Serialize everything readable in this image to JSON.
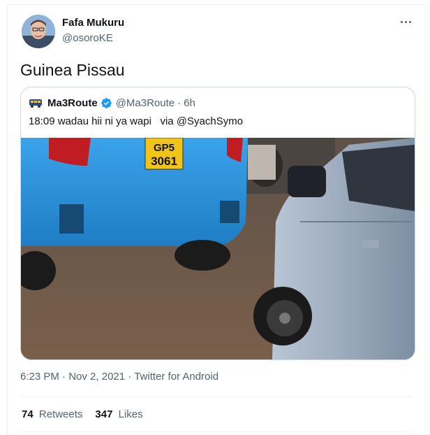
{
  "tweet": {
    "author": {
      "name": "Fafa Mukuru",
      "handle": "@osoroKE"
    },
    "text": "Guinea Pissau",
    "quoted": {
      "name": "Ma3Route",
      "handle": "@Ma3Route",
      "separator": "·",
      "time": "6h",
      "text": "18:09 wadau hii ni ya wapi   via @SyachSymo",
      "plate_text_1": "GP5",
      "plate_text_2": "3061"
    },
    "meta": {
      "time": "6:23 PM",
      "sep1": "·",
      "date": "Nov 2, 2021",
      "sep2": "·",
      "client": "Twitter for Android"
    },
    "stats": {
      "retweets_count": "74",
      "retweets_label": "Retweets",
      "likes_count": "347",
      "likes_label": "Likes"
    }
  },
  "colors": {
    "verified": "#1d9bf0",
    "secondary_text": "#536471",
    "border": "#cfd9de",
    "car_blue": "#2c8fd6"
  },
  "icons": {
    "more": "more-horizontal-icon",
    "verified": "verified-badge-icon"
  }
}
